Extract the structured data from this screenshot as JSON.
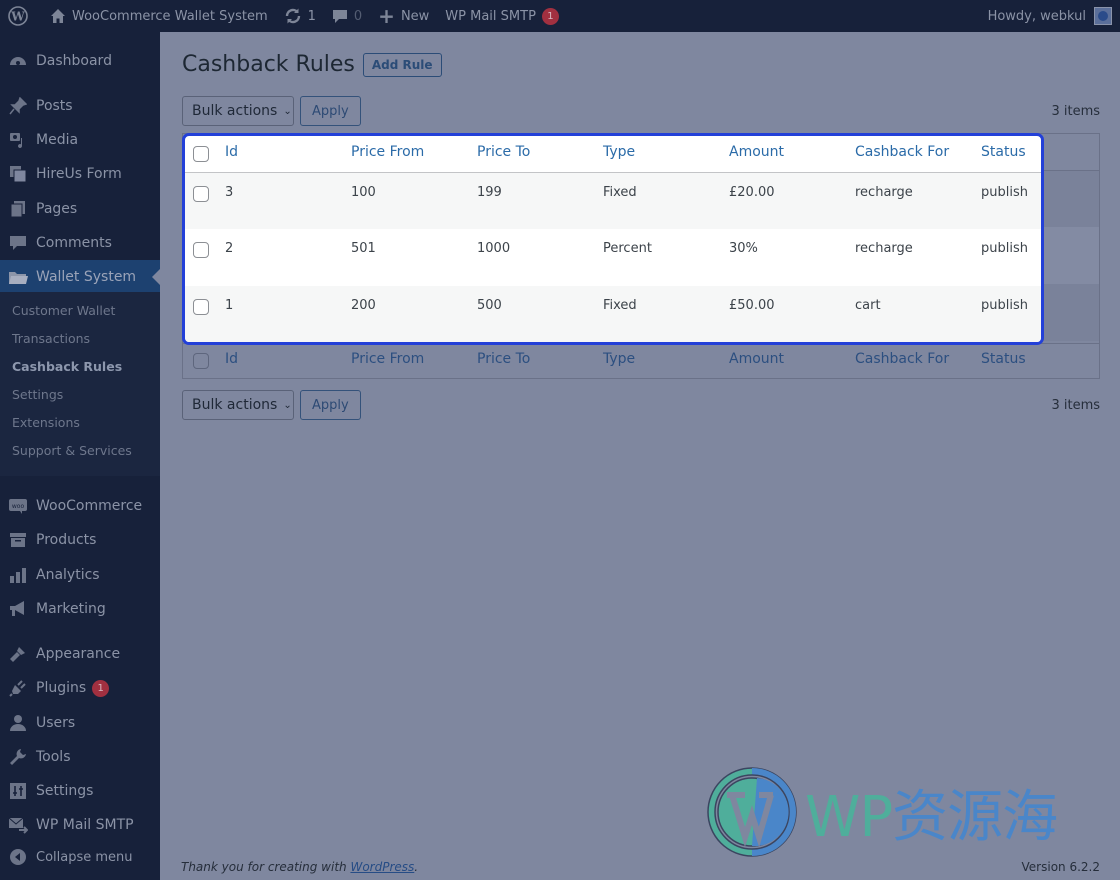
{
  "adminbar": {
    "site_name": "WooCommerce Wallet System",
    "updates_count": "1",
    "comments_count": "0",
    "new_label": "New",
    "wp_mail_smtp_label": "WP Mail SMTP",
    "wp_mail_smtp_badge": "1",
    "howdy": "Howdy, webkul"
  },
  "sidebar": {
    "items": [
      {
        "label": "Dashboard",
        "icon": "dashboard-icon"
      },
      {
        "label": "Posts",
        "icon": "pin-icon"
      },
      {
        "label": "Media",
        "icon": "media-icon"
      },
      {
        "label": "HireUs Form",
        "icon": "form-icon"
      },
      {
        "label": "Pages",
        "icon": "pages-icon"
      },
      {
        "label": "Comments",
        "icon": "comment-icon"
      },
      {
        "label": "Wallet System",
        "icon": "folder-icon"
      },
      {
        "label": "WooCommerce",
        "icon": "woo-icon"
      },
      {
        "label": "Products",
        "icon": "archive-icon"
      },
      {
        "label": "Analytics",
        "icon": "bar-chart-icon"
      },
      {
        "label": "Marketing",
        "icon": "megaphone-icon"
      },
      {
        "label": "Appearance",
        "icon": "brush-icon"
      },
      {
        "label": "Plugins",
        "icon": "plug-icon",
        "badge": "1"
      },
      {
        "label": "Users",
        "icon": "user-icon"
      },
      {
        "label": "Tools",
        "icon": "wrench-icon"
      },
      {
        "label": "Settings",
        "icon": "sliders-icon"
      },
      {
        "label": "WP Mail SMTP",
        "icon": "mail-icon"
      },
      {
        "label": "Collapse menu",
        "icon": "collapse-icon"
      }
    ],
    "submenu": [
      "Customer Wallet",
      "Transactions",
      "Cashback Rules",
      "Settings",
      "Extensions",
      "Support & Services"
    ],
    "current_submenu": "Cashback Rules"
  },
  "page": {
    "title": "Cashback Rules",
    "add_rule_label": "Add Rule",
    "bulk_actions_label": "Bulk actions",
    "apply_label": "Apply",
    "items_count": "3 items"
  },
  "table": {
    "columns": [
      "Id",
      "Price From",
      "Price To",
      "Type",
      "Amount",
      "Cashback For",
      "Status"
    ],
    "rows": [
      {
        "id": "3",
        "price_from": "100",
        "price_to": "199",
        "type": "Fixed",
        "amount": "£20.00",
        "cashback_for": "recharge",
        "status": "publish"
      },
      {
        "id": "2",
        "price_from": "501",
        "price_to": "1000",
        "type": "Percent",
        "amount": "30%",
        "cashback_for": "recharge",
        "status": "publish"
      },
      {
        "id": "1",
        "price_from": "200",
        "price_to": "500",
        "type": "Fixed",
        "amount": "£50.00",
        "cashback_for": "cart",
        "status": "publish"
      }
    ]
  },
  "footer": {
    "thanks_prefix": "Thank you for creating with ",
    "thanks_link": "WordPress",
    "thanks_suffix": ".",
    "version": "Version 6.2.2"
  },
  "watermark": {
    "latin": "WP",
    "cjk": "资源海"
  },
  "colors": {
    "accent": "#2271b1",
    "focus_outline": "#2340d8",
    "badge": "#a13040"
  }
}
